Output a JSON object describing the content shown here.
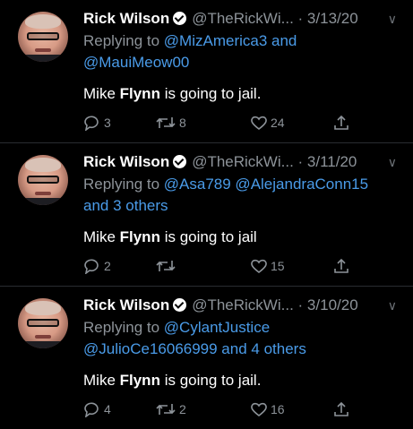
{
  "tweets": [
    {
      "name": "Rick Wilson",
      "handle": "@TheRickWi...",
      "date": "· 3/13/20",
      "reply_prefix": "Replying to",
      "reply_mentions": "@MizAmerica3",
      "reply_join": " and",
      "reply_more": "@MauiMeow00",
      "body_pre": "Mike ",
      "body_bold": "Flynn",
      "body_post": " is going to jail.",
      "replies": "3",
      "retweets": "8",
      "likes": "24"
    },
    {
      "name": "Rick Wilson",
      "handle": "@TheRickWi...",
      "date": "· 3/11/20",
      "reply_prefix": "Replying to",
      "reply_mentions": "@Asa789 @AlejandraConn15",
      "reply_join": "",
      "reply_more": "and 3 others",
      "body_pre": "Mike ",
      "body_bold": "Flynn",
      "body_post": " is going to jail",
      "replies": "2",
      "retweets": "",
      "likes": "15"
    },
    {
      "name": "Rick Wilson",
      "handle": "@TheRickWi...",
      "date": "· 3/10/20",
      "reply_prefix": "Replying to",
      "reply_mentions": "@CylantJustice",
      "reply_join": "",
      "reply_more": "@JulioCe16066999 and 4 others",
      "body_pre": "Mike ",
      "body_bold": "Flynn",
      "body_post": " is going to jail.",
      "replies": "4",
      "retweets": "2",
      "likes": "16"
    }
  ],
  "icons": [
    "verified-badge-icon",
    "chevron-down-icon",
    "reply-icon",
    "retweet-icon",
    "like-icon",
    "share-icon"
  ],
  "colors": {
    "background": "#000000",
    "mention": "#4a9be8",
    "secondary": "#8d9399"
  }
}
